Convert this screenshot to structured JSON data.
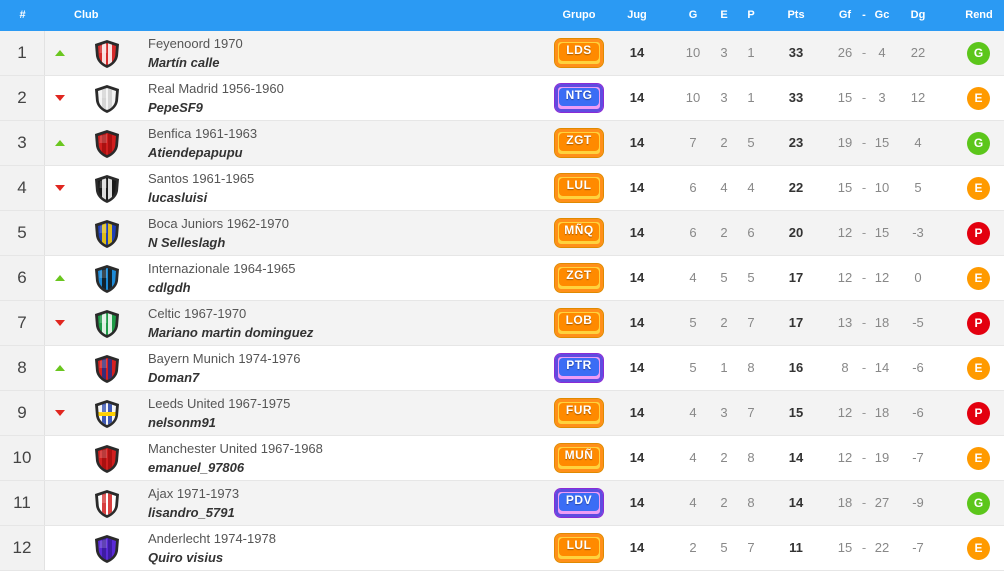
{
  "header": {
    "rank": "#",
    "club": "Club",
    "group": "Grupo",
    "played": "Jug",
    "won": "G",
    "drawn": "E",
    "lost": "P",
    "points": "Pts",
    "goals_for": "Gf",
    "goals_sep": "-",
    "goals_against": "Gc",
    "goal_diff": "Dg",
    "performance": "Rend"
  },
  "rows": [
    {
      "rank": "1",
      "trend": "up",
      "club": "Feyenoord 1970",
      "manager": "Martín calle",
      "crest": "crest-red-white",
      "group": "LDS",
      "group_style": "orange",
      "played": "14",
      "won": "10",
      "drawn": "3",
      "lost": "1",
      "points": "33",
      "gf": "26",
      "sep": "-",
      "gc": "4",
      "dg": "22",
      "rend": "G"
    },
    {
      "rank": "2",
      "trend": "down",
      "club": "Real Madrid 1956-1960",
      "manager": "PepeSF9",
      "crest": "crest-white",
      "group": "NTG",
      "group_style": "purple",
      "played": "14",
      "won": "10",
      "drawn": "3",
      "lost": "1",
      "points": "33",
      "gf": "15",
      "sep": "-",
      "gc": "3",
      "dg": "12",
      "rend": "E"
    },
    {
      "rank": "3",
      "trend": "up",
      "club": "Benfica 1961-1963",
      "manager": "Atiendepapupu",
      "crest": "crest-red",
      "group": "ZGT",
      "group_style": "orange",
      "played": "14",
      "won": "7",
      "drawn": "2",
      "lost": "5",
      "points": "23",
      "gf": "19",
      "sep": "-",
      "gc": "15",
      "dg": "4",
      "rend": "G"
    },
    {
      "rank": "4",
      "trend": "down",
      "club": "Santos 1961-1965",
      "manager": "lucasluisi",
      "crest": "crest-black-white",
      "group": "LUL",
      "group_style": "orange",
      "played": "14",
      "won": "6",
      "drawn": "4",
      "lost": "4",
      "points": "22",
      "gf": "15",
      "sep": "-",
      "gc": "10",
      "dg": "5",
      "rend": "E"
    },
    {
      "rank": "5",
      "trend": "none",
      "club": "Boca Juniors 1962-1970",
      "manager": "N Selleslagh",
      "crest": "crest-blue-yellow",
      "group": "MÑQ",
      "group_style": "orange",
      "played": "14",
      "won": "6",
      "drawn": "2",
      "lost": "6",
      "points": "20",
      "gf": "12",
      "sep": "-",
      "gc": "15",
      "dg": "-3",
      "rend": "P"
    },
    {
      "rank": "6",
      "trend": "up",
      "club": "Internazionale 1964-1965",
      "manager": "cdlgdh",
      "crest": "crest-blue-black",
      "group": "ZGT",
      "group_style": "orange",
      "played": "14",
      "won": "4",
      "drawn": "5",
      "lost": "5",
      "points": "17",
      "gf": "12",
      "sep": "-",
      "gc": "12",
      "dg": "0",
      "rend": "E"
    },
    {
      "rank": "7",
      "trend": "down",
      "club": "Celtic 1967-1970",
      "manager": "Mariano martin dominguez",
      "crest": "crest-green-white",
      "group": "LOB",
      "group_style": "orange",
      "played": "14",
      "won": "5",
      "drawn": "2",
      "lost": "7",
      "points": "17",
      "gf": "13",
      "sep": "-",
      "gc": "18",
      "dg": "-5",
      "rend": "P"
    },
    {
      "rank": "8",
      "trend": "up",
      "club": "Bayern Munich 1974-1976",
      "manager": "Doman7",
      "crest": "crest-red-blue",
      "group": "PTR",
      "group_style": "purple",
      "played": "14",
      "won": "5",
      "drawn": "1",
      "lost": "8",
      "points": "16",
      "gf": "8",
      "sep": "-",
      "gc": "14",
      "dg": "-6",
      "rend": "E"
    },
    {
      "rank": "9",
      "trend": "down",
      "club": "Leeds United 1967-1975",
      "manager": "nelsonm91",
      "crest": "crest-white-blue-yellow",
      "group": "FUR",
      "group_style": "orange",
      "played": "14",
      "won": "4",
      "drawn": "3",
      "lost": "7",
      "points": "15",
      "gf": "12",
      "sep": "-",
      "gc": "18",
      "dg": "-6",
      "rend": "P"
    },
    {
      "rank": "10",
      "trend": "none",
      "club": "Manchester United 1967-1968",
      "manager": "emanuel_97806",
      "crest": "crest-red",
      "group": "MUÑ",
      "group_style": "orange",
      "played": "14",
      "won": "4",
      "drawn": "2",
      "lost": "8",
      "points": "14",
      "gf": "12",
      "sep": "-",
      "gc": "19",
      "dg": "-7",
      "rend": "E"
    },
    {
      "rank": "11",
      "trend": "none",
      "club": "Ajax 1971-1973",
      "manager": "lisandro_5791",
      "crest": "crest-white-red",
      "group": "PDV",
      "group_style": "purple",
      "played": "14",
      "won": "4",
      "drawn": "2",
      "lost": "8",
      "points": "14",
      "gf": "18",
      "sep": "-",
      "gc": "27",
      "dg": "-9",
      "rend": "G"
    },
    {
      "rank": "12",
      "trend": "none",
      "club": "Anderlecht 1974-1978",
      "manager": "Quiro visius",
      "crest": "crest-purple",
      "group": "LUL",
      "group_style": "orange",
      "played": "14",
      "won": "2",
      "drawn": "5",
      "lost": "7",
      "points": "11",
      "gf": "15",
      "sep": "-",
      "gc": "22",
      "dg": "-7",
      "rend": "E"
    }
  ],
  "colors": {
    "header_bg": "#2b9af3",
    "trend_up": "#6ac61f",
    "trend_down": "#e0261f",
    "rend_G": "#5cc61b",
    "rend_E": "#ff9a00",
    "rend_P": "#e3000f"
  },
  "crest_colors": {
    "crest-red-white": [
      "#d62a2a",
      "#ffffff"
    ],
    "crest-white": [
      "#f4f4f4",
      "#cfcfcf"
    ],
    "crest-red": [
      "#d11f1f",
      "#a30f0f"
    ],
    "crest-black-white": [
      "#1a1a1a",
      "#ffffff"
    ],
    "crest-blue-yellow": [
      "#1f3fb5",
      "#ffd400"
    ],
    "crest-blue-black": [
      "#1e8ad6",
      "#111111"
    ],
    "crest-green-white": [
      "#1e9b47",
      "#ffffff"
    ],
    "crest-red-blue": [
      "#d62020",
      "#1d2f8a"
    ],
    "crest-white-blue-yellow": [
      "#f6f6f6",
      "#1d3ca8",
      "#ffd000"
    ],
    "crest-white-red": [
      "#ffffff",
      "#d11f1f"
    ],
    "crest-purple": [
      "#5a2ad6",
      "#3a1a9a"
    ]
  }
}
